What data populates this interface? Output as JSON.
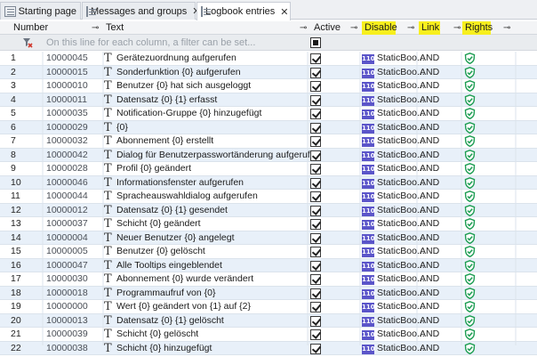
{
  "tabs": [
    {
      "label": "Starting page",
      "active": false,
      "closable": false,
      "icon": "page-icon"
    },
    {
      "label": "Messages and groups",
      "active": false,
      "closable": true,
      "icon": "table-icon"
    },
    {
      "label": "Logbook entries",
      "active": true,
      "closable": true,
      "icon": "table-icon"
    }
  ],
  "close_glyph": "✕",
  "columns": {
    "number": "Number",
    "text": "Text",
    "active": "Active",
    "disable": "Disable",
    "link": "Link",
    "rights": "Rights",
    "pin_glyph": "⊸"
  },
  "filter": {
    "placeholder": "On this line for each column, a filter can be set..."
  },
  "colors": {
    "highlight": "#f7ef1e",
    "alt_row": "#e8f0f9",
    "badge": "#5b55c9",
    "shield": "#1f9e54"
  },
  "badge_text": "110",
  "rows": [
    {
      "idx": "1",
      "number": "10000045",
      "text": "Gerätezuordnung aufgerufen",
      "disable": "StaticBoo...",
      "link": "AND"
    },
    {
      "idx": "2",
      "number": "10000015",
      "text": "Sonderfunktion {0} aufgerufen",
      "disable": "StaticBoo...",
      "link": "AND"
    },
    {
      "idx": "3",
      "number": "10000010",
      "text": "Benutzer {0} hat sich ausgeloggt",
      "disable": "StaticBoo...",
      "link": "AND"
    },
    {
      "idx": "4",
      "number": "10000011",
      "text": "Datensatz {0} {1} erfasst",
      "disable": "StaticBoo...",
      "link": "AND"
    },
    {
      "idx": "5",
      "number": "10000035",
      "text": "Notification-Gruppe {0} hinzugefügt",
      "disable": "StaticBoo...",
      "link": "AND"
    },
    {
      "idx": "6",
      "number": "10000029",
      "text": "{0}",
      "disable": "StaticBoo...",
      "link": "AND"
    },
    {
      "idx": "7",
      "number": "10000032",
      "text": "Abonnement {0} erstellt",
      "disable": "StaticBoo...",
      "link": "AND"
    },
    {
      "idx": "8",
      "number": "10000042",
      "text": "Dialog für Benutzerpasswortänderung aufgerufen",
      "disable": "StaticBoo...",
      "link": "AND"
    },
    {
      "idx": "9",
      "number": "10000028",
      "text": "Profil {0} geändert",
      "disable": "StaticBoo...",
      "link": "AND"
    },
    {
      "idx": "10",
      "number": "10000046",
      "text": "Informationsfenster aufgerufen",
      "disable": "StaticBoo...",
      "link": "AND"
    },
    {
      "idx": "11",
      "number": "10000044",
      "text": "Spracheauswahldialog aufgerufen",
      "disable": "StaticBoo...",
      "link": "AND"
    },
    {
      "idx": "12",
      "number": "10000012",
      "text": "Datensatz {0} {1} gesendet",
      "disable": "StaticBoo...",
      "link": "AND"
    },
    {
      "idx": "13",
      "number": "10000037",
      "text": "Schicht {0} geändert",
      "disable": "StaticBoo...",
      "link": "AND"
    },
    {
      "idx": "14",
      "number": "10000004",
      "text": "Neuer Benutzer {0} angelegt",
      "disable": "StaticBoo...",
      "link": "AND"
    },
    {
      "idx": "15",
      "number": "10000005",
      "text": "Benutzer {0} gelöscht",
      "disable": "StaticBoo...",
      "link": "AND"
    },
    {
      "idx": "16",
      "number": "10000047",
      "text": "Alle Tooltips eingeblendet",
      "disable": "StaticBoo...",
      "link": "AND"
    },
    {
      "idx": "17",
      "number": "10000030",
      "text": "Abonnement {0} wurde verändert",
      "disable": "StaticBoo...",
      "link": "AND"
    },
    {
      "idx": "18",
      "number": "10000018",
      "text": "Programmaufruf von {0}",
      "disable": "StaticBoo...",
      "link": "AND"
    },
    {
      "idx": "19",
      "number": "10000000",
      "text": "Wert {0} geändert von {1} auf {2}",
      "disable": "StaticBoo...",
      "link": "AND"
    },
    {
      "idx": "20",
      "number": "10000013",
      "text": "Datensatz {0} {1} gelöscht",
      "disable": "StaticBoo...",
      "link": "AND"
    },
    {
      "idx": "21",
      "number": "10000039",
      "text": "Schicht {0} gelöscht",
      "disable": "StaticBoo...",
      "link": "AND"
    },
    {
      "idx": "22",
      "number": "10000038",
      "text": "Schicht {0} hinzugefügt",
      "disable": "StaticBoo...",
      "link": "AND"
    }
  ]
}
